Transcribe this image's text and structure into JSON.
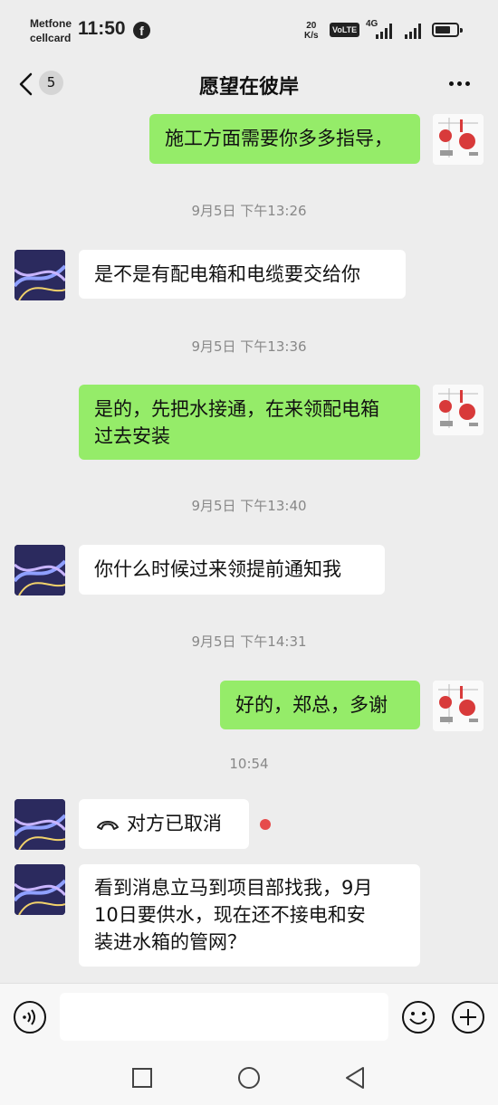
{
  "status_bar": {
    "carrier_line1": "Metfone",
    "carrier_line2": "cellcard",
    "time": "11:50",
    "net_speed_value": "20",
    "net_speed_unit": "K/s",
    "volte": "VoLTE",
    "network": "4G",
    "facebook_icon": "f"
  },
  "header": {
    "unread_count": "5",
    "title": "愿望在彼岸"
  },
  "messages": [
    {
      "type": "sent",
      "text": "施工方面需要你多多指导，"
    },
    {
      "type": "time",
      "text": "9月5日 下午13:26"
    },
    {
      "type": "recv",
      "text": "是不是有配电箱和电缆要交给你"
    },
    {
      "type": "time",
      "text": "9月5日 下午13:36"
    },
    {
      "type": "sent",
      "line1": "是的，先把水接通，在来领配电箱",
      "line2": "过去安装"
    },
    {
      "type": "time",
      "text": "9月5日 下午13:40"
    },
    {
      "type": "recv",
      "text": "你什么时候过来领提前通知我"
    },
    {
      "type": "time",
      "text": "9月5日 下午14:31"
    },
    {
      "type": "sent",
      "text": "好的，郑总，多谢"
    },
    {
      "type": "time",
      "text": "10:54"
    },
    {
      "type": "call",
      "text": "对方已取消"
    },
    {
      "type": "recv",
      "line1": "看到消息立马到项目部找我，9月",
      "line2": "10日要供水，现在还不接电和安",
      "line3": "装进水箱的管网？"
    }
  ],
  "colors": {
    "sent_bubble": "#95ec69",
    "recv_bubble": "#ffffff",
    "background": "#ededed",
    "missed_dot": "#e64c4c"
  },
  "icons": [
    "back-icon",
    "more-icon",
    "voice-icon",
    "emoji-icon",
    "plus-icon",
    "phone-icon",
    "recent-apps-icon",
    "home-icon",
    "back-nav-icon"
  ]
}
